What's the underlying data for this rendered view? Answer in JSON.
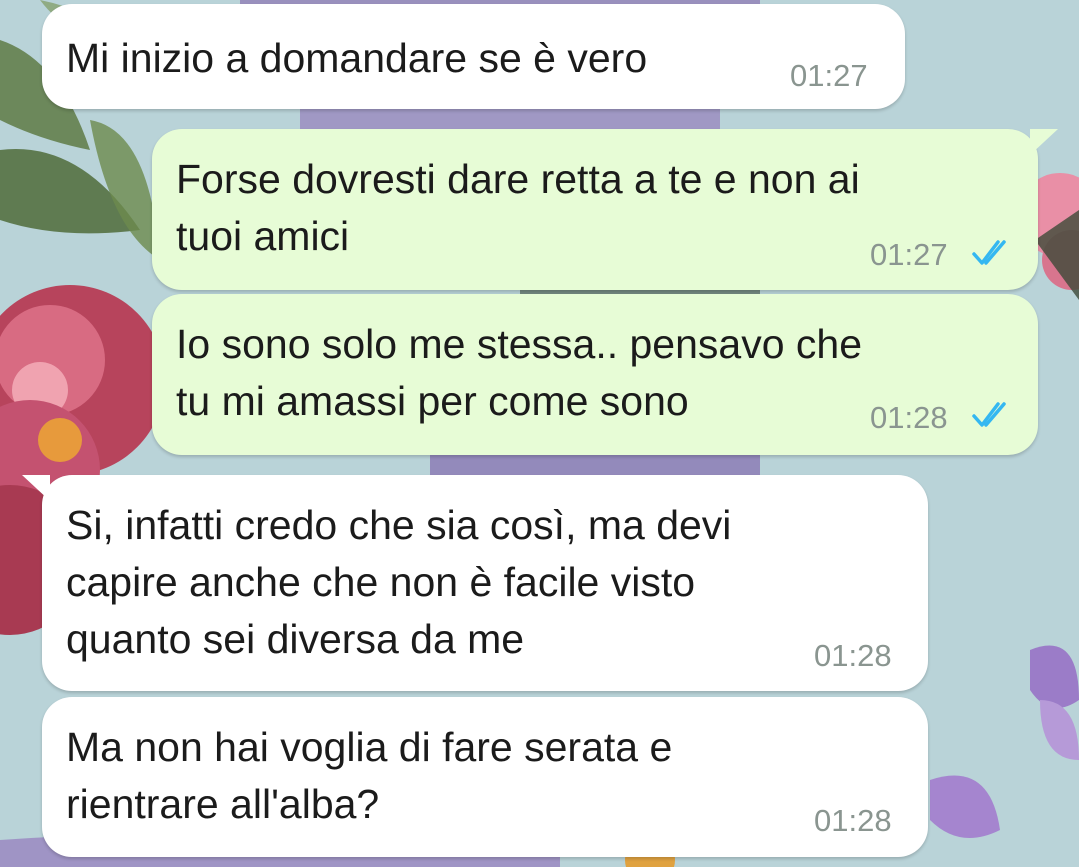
{
  "chat": {
    "messages": [
      {
        "direction": "incoming",
        "text": "Mi inizio a domandare se è vero",
        "time": "01:27"
      },
      {
        "direction": "outgoing",
        "text": "Forse dovresti dare retta a te e non ai\ntuoi amici",
        "time": "01:27",
        "status": "read-double-check-icon"
      },
      {
        "direction": "outgoing",
        "text": "Io sono solo me stessa.. pensavo che\ntu mi amassi per come sono",
        "time": "01:28",
        "status": "read-double-check-icon"
      },
      {
        "direction": "incoming",
        "text": "Si, infatti credo che sia così, ma devi\ncapire anche che non è facile visto\nquanto sei diversa da me",
        "time": "01:28"
      },
      {
        "direction": "incoming",
        "text": "Ma non hai voglia di fare serata e\nrientrare all'alba?",
        "time": "01:28"
      }
    ]
  },
  "colors": {
    "incoming_bubble": "#ffffff",
    "outgoing_bubble": "#e7fcd6",
    "read_ticks": "#34b7f1",
    "timestamp": "#8a9590",
    "wallpaper_base": "#b9d3d8"
  }
}
